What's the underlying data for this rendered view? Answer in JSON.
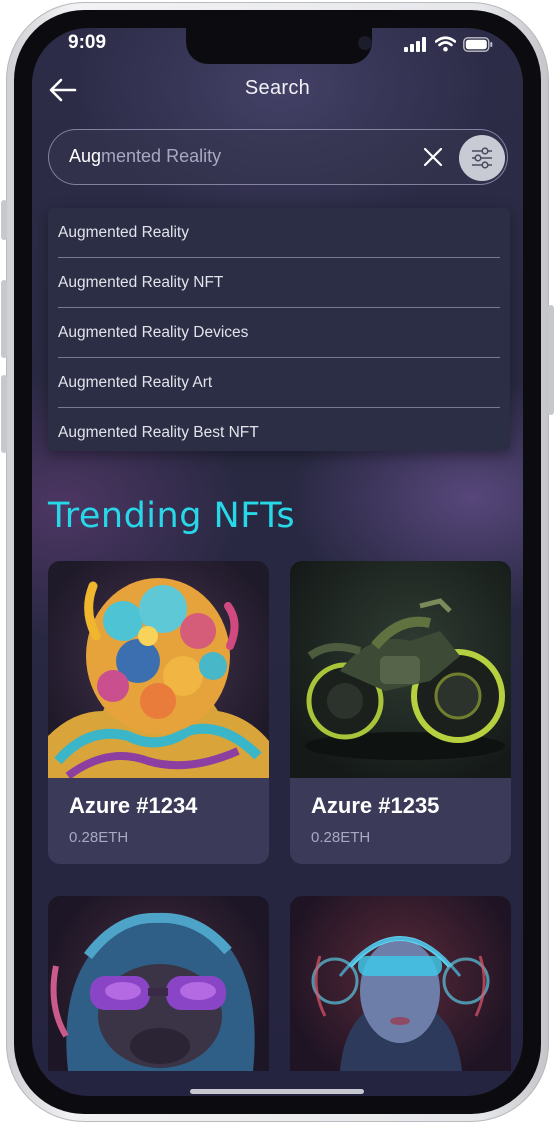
{
  "status_bar": {
    "time": "9:09"
  },
  "header": {
    "title": "Search"
  },
  "search": {
    "typed": "Aug",
    "completion": "mented Reality"
  },
  "suggestions": [
    "Augmented Reality",
    "Augmented Reality NFT",
    "Augmented Reality Devices",
    "Augmented Reality Art",
    "Augmented Reality Best NFT"
  ],
  "section": {
    "title": "Trending NFTs"
  },
  "nfts": [
    {
      "name": "Azure #1234",
      "price": "0.28ETH",
      "image": "colorful-sculpture-figure"
    },
    {
      "name": "Azure #1235",
      "price": "0.28ETH",
      "image": "green-motorcycle"
    },
    {
      "image": "ape-with-goggles"
    },
    {
      "image": "cyber-woman-headset"
    }
  ],
  "colors": {
    "accent": "#27d8e8",
    "background": "#292942",
    "card": "#403f5e",
    "filter_button": "#c9cbd4"
  }
}
